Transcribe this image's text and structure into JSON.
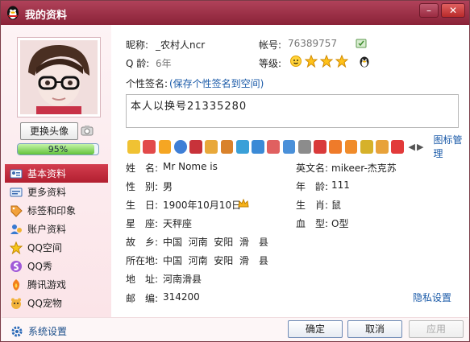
{
  "window": {
    "title": "我的资料"
  },
  "avatar": {
    "change_button": "更换头像",
    "progress_percent": 95,
    "progress_text": "95%"
  },
  "nav": {
    "items": [
      {
        "label": "基本资料",
        "icon": "profile-card-icon",
        "active": true
      },
      {
        "label": "更多资料",
        "icon": "more-info-icon"
      },
      {
        "label": "标签和印象",
        "icon": "tags-icon"
      },
      {
        "label": "账户资料",
        "icon": "account-icon"
      },
      {
        "label": "QQ空间",
        "icon": "qzone-icon"
      },
      {
        "label": "QQ秀",
        "icon": "qqshow-icon"
      },
      {
        "label": "腾讯游戏",
        "icon": "games-icon"
      },
      {
        "label": "QQ宠物",
        "icon": "pet-icon"
      }
    ],
    "settings": "系统设置"
  },
  "header": {
    "nickname_label": "昵称:",
    "nickname_value": "_农村人ncr",
    "account_label": "帐号:",
    "account_value": "76389757",
    "qage_label": "Q 龄:",
    "qage_value": "6年",
    "level_label": "等级:",
    "signature_label": "个性签名:",
    "signature_link": "(保存个性签名到空间)",
    "signature_value": "本人以换号21335280"
  },
  "icon_manage": "图标管理",
  "fields": {
    "name": {
      "label": "姓　名:",
      "value": "Mr Nome is"
    },
    "english_name": {
      "label": "英文名:",
      "value": "mikeer-杰克苏"
    },
    "gender": {
      "label": "性　别:",
      "value": "男"
    },
    "age": {
      "label": "年　龄:",
      "value": "111"
    },
    "birthday": {
      "label": "生　日:",
      "value": "1900年10月10日"
    },
    "zodiac": {
      "label": "生　肖:",
      "value": "鼠"
    },
    "constellation": {
      "label": "星　座:",
      "value": "天秤座"
    },
    "blood": {
      "label": "血　型:",
      "value": "O型"
    },
    "hometown": {
      "label": "故　乡:",
      "value": "中国  河南  安阳  滑　县"
    },
    "location": {
      "label": "所在地:",
      "value": "中国  河南  安阳  滑　县"
    },
    "address": {
      "label": "地　址:",
      "value": "河南滑县"
    },
    "zipcode": {
      "label": "邮　编:",
      "value": "314200"
    }
  },
  "privacy_link": "隐私设置",
  "buttons": {
    "ok": "确定",
    "cancel": "取消",
    "apply": "应用"
  },
  "colors": {
    "title_bar": "#9a2e45",
    "active_nav": "#c22c3d",
    "link": "#1a5aa8"
  }
}
